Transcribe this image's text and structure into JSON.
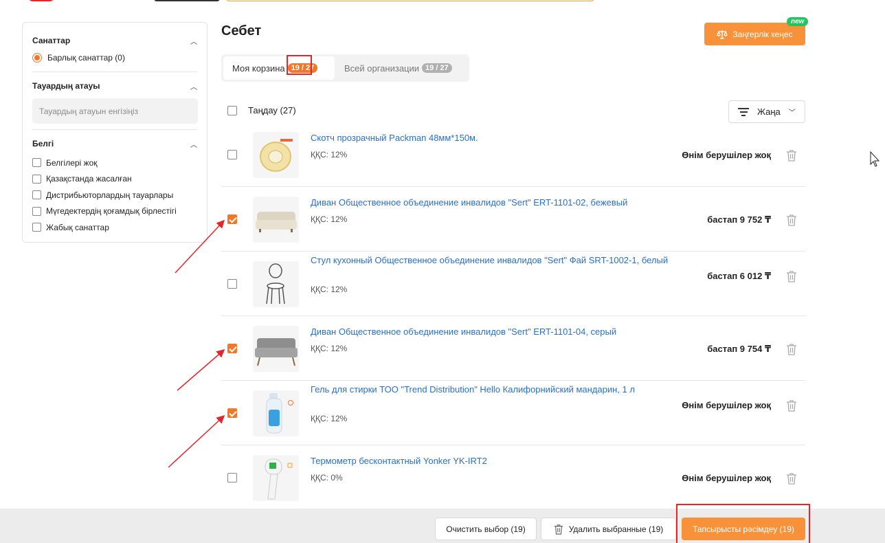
{
  "colors": {
    "accent": "#f0782a",
    "button_orange": "#f7923a",
    "link": "#2a6fc9",
    "badge_green": "#22c55e",
    "annotation_red": "#e3262c"
  },
  "sidebar": {
    "categories": {
      "title": "Санаттар",
      "all_label": "Барлық санаттар (0)"
    },
    "product_name": {
      "title": "Тауардың атауы",
      "placeholder": "Тауардың атауын енгізіңіз"
    },
    "marks": {
      "title": "Белгі",
      "options": [
        "Белгілері жоқ",
        "Қазақстанда жасалған",
        "Дистрибьюторлардың тауарлары",
        "Мүгедектердің қоғамдық бірлестігі",
        "Жабық санаттар"
      ]
    }
  },
  "header": {
    "title": "Себет",
    "legal_button": "Заңгерлік кеңес",
    "new_badge": "new"
  },
  "tabs": [
    {
      "label": "Моя корзина",
      "count": "19 / 27",
      "active": true
    },
    {
      "label": "Всей организации",
      "count": "19 / 27",
      "active": false
    }
  ],
  "select_all_label": "Таңдау (27)",
  "sort": {
    "label": "Жаңа",
    "icon": "filter-lines-icon"
  },
  "products": [
    {
      "name": "Скотч прозрачный Packman 48мм*150м.",
      "vat": "ҚҚС: 12%",
      "price": "Өнім берушілер жоқ",
      "checked": false,
      "icon": "tape-thumbnail"
    },
    {
      "name": "Диван Общественное объединение инвалидов \"Sert\" ERT-1101-02, бежевый",
      "vat": "ҚҚС: 12%",
      "price": "бастап 9 752 ₸",
      "checked": true,
      "icon": "sofa-beige-thumbnail"
    },
    {
      "name": "Стул кухонный Общественное объединение инвалидов \"Sert\" Фай SRT-1002-1, белый",
      "vat": "ҚҚС: 12%",
      "price": "бастап 6 012 ₸",
      "checked": false,
      "icon": "chair-thumbnail"
    },
    {
      "name": "Диван Общественное объединение инвалидов \"Sert\" ERT-1101-04, серый",
      "vat": "ҚҚС: 12%",
      "price": "бастап 9 754 ₸",
      "checked": true,
      "icon": "sofa-grey-thumbnail"
    },
    {
      "name": "Гель для стирки ТОО \"Trend Distribution\" Hello Калифорнийский мандарин, 1 л",
      "vat": "ҚҚС: 12%",
      "price": "Өнім берушілер жоқ",
      "checked": true,
      "icon": "gel-bottle-thumbnail"
    },
    {
      "name": "Термометр бесконтактный Yonker YK-IRT2",
      "vat": "ҚҚС: 0%",
      "price": "Өнім берушілер жоқ",
      "checked": false,
      "icon": "thermometer-thumbnail"
    }
  ],
  "footer": {
    "clear_label": "Очистить выбор (19)",
    "delete_label": "Удалить выбранные (19)",
    "order_label": "Тапсырысты рәсімдеу (19)"
  }
}
